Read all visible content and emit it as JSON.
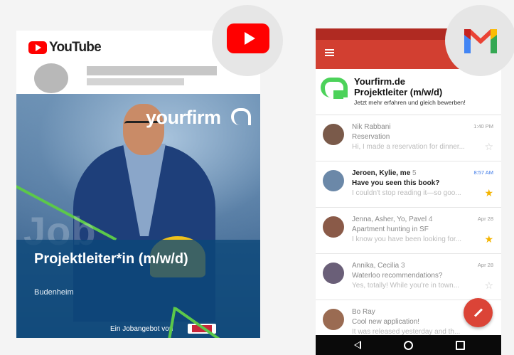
{
  "youtube": {
    "wordmark": "YouTube",
    "ad": {
      "brand": "yourfirm",
      "watermark": "Job",
      "title": "Projektleiter*in (m/w/d)",
      "location": "Budenheim",
      "offer_by": "Ein Jobangebot von"
    }
  },
  "gmail": {
    "ad": {
      "line1": "Yourfirm.de",
      "line2": "Projektleiter (m/w/d)",
      "line3": "Jetzt mehr erfahren und gleich bewerben!"
    },
    "emails": [
      {
        "from": "Nik Rabbani",
        "count": "",
        "subject": "Reservation",
        "snippet": "Hi, I made a reservation for dinner...",
        "time": "1:40 PM",
        "unread": false,
        "starred": false,
        "avatar_color": "#7a5a4a"
      },
      {
        "from": "Jeroen, Kylie, me",
        "count": "5",
        "subject": "Have you seen this book?",
        "snippet": "I couldn't stop reading it—so goo...",
        "time": "8:57 AM",
        "unread": true,
        "starred": true,
        "avatar_color": "#6b88a8"
      },
      {
        "from": "Jenna, Asher, Yo, Pavel",
        "count": "4",
        "subject": "Apartment hunting in SF",
        "snippet": "I know you have been looking for...",
        "time": "Apr 28",
        "unread": false,
        "starred": true,
        "avatar_color": "#8a5a48"
      },
      {
        "from": "Annika, Cecilia",
        "count": "3",
        "subject": "Waterloo recommendations?",
        "snippet": "Yes, totally! While you're in town...",
        "time": "Apr 28",
        "unread": false,
        "starred": false,
        "avatar_color": "#6a5f78"
      },
      {
        "from": "Bo Ray",
        "count": "",
        "subject": "Cool new application!",
        "snippet": "It was released yesterday and th...",
        "time": "",
        "unread": false,
        "starred": false,
        "avatar_color": "#9a6b52"
      }
    ]
  },
  "colors": {
    "youtube_red": "#ff0000",
    "gmail_red": "#d23f31",
    "accent_green": "#4cd25a",
    "unread_time_blue": "#3b78e7",
    "star_yellow": "#f4b400"
  }
}
